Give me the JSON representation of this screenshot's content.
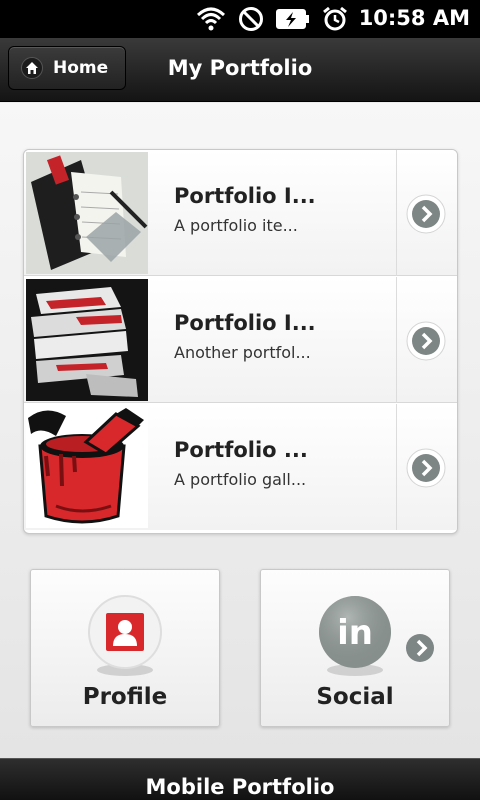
{
  "status_bar": {
    "time": "10:58 AM",
    "icons": [
      "wifi-icon",
      "no-sound-icon",
      "battery-charging-icon",
      "alarm-clock-icon"
    ]
  },
  "header": {
    "home_label": "Home",
    "title": "My Portfolio"
  },
  "portfolio_items": [
    {
      "title": "Portfolio I...",
      "description": "A portfolio ite...",
      "thumbnail": "planner-icon"
    },
    {
      "title": "Portfolio I...",
      "description": "Another portfol...",
      "thumbnail": "paper-stack-icon"
    },
    {
      "title": "Portfolio ...",
      "description": "A portfolio gall...",
      "thumbnail": "paint-can-icon"
    }
  ],
  "tiles": [
    {
      "label": "Profile",
      "icon": "profile-icon"
    },
    {
      "label": "Social",
      "icon": "linkedin-icon",
      "icon_text": "in"
    }
  ],
  "footer": {
    "title": "Mobile Portfolio"
  },
  "colors": {
    "accent_red": "#d8282c",
    "header_dark": "#1a1a1a",
    "arrow_gray": "#7d8585"
  }
}
